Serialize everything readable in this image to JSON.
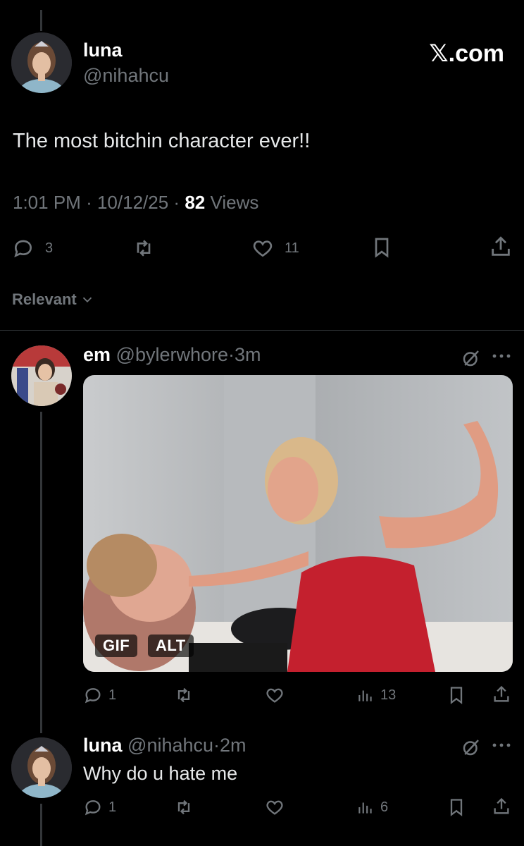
{
  "top_line": "",
  "main_post": {
    "display_name": "luna",
    "handle": "@nihahcu",
    "brand": "𝕏.com",
    "text": "The most bitchin character ever!!",
    "time": "1:01 PM",
    "date": "10/12/25",
    "views_count": "82",
    "views_label": "Views",
    "replies": "3",
    "likes": "11"
  },
  "sort": {
    "label": "Relevant"
  },
  "replies": [
    {
      "display_name": "em",
      "handle": "@bylerwhore",
      "age": "3m",
      "media_badges": [
        "GIF",
        "ALT"
      ],
      "actions": {
        "replies": "1",
        "views": "13"
      }
    },
    {
      "display_name": "luna",
      "handle": "@nihahcu",
      "age": "2m",
      "text": "Why do u hate me",
      "actions": {
        "replies": "1",
        "views": "6"
      }
    }
  ],
  "separator": "·",
  "icons": [
    "reply-icon",
    "repost-icon",
    "like-icon",
    "bookmark-icon",
    "share-icon",
    "views-icon",
    "grok-icon",
    "more-icon",
    "chevron-down-icon"
  ],
  "colors": {
    "background": "#000000",
    "text": "#e7e9ea",
    "muted": "#71767b",
    "divider": "#2f3336",
    "shirt_red": "#c4202e"
  }
}
